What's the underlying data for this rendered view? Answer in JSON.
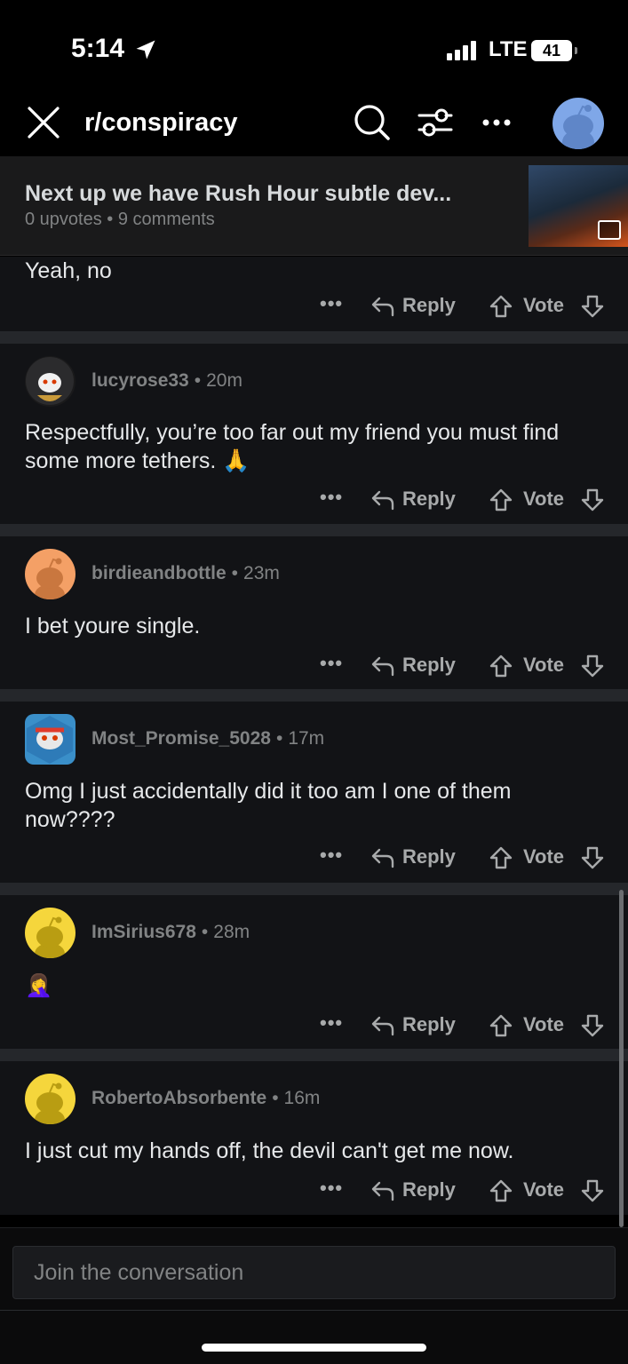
{
  "status_bar": {
    "time": "5:14",
    "network": "LTE",
    "battery": "41"
  },
  "header": {
    "subreddit": "r/conspiracy"
  },
  "post": {
    "title": "Next up we have Rush Hour  subtle dev...",
    "upvotes": "0 upvotes",
    "comments": "9 comments"
  },
  "actions": {
    "more": "•••",
    "reply": "Reply",
    "vote": "Vote"
  },
  "partial_comment": {
    "body": "Yeah, no"
  },
  "comments": [
    {
      "user": "lucyrose33",
      "ago": "20m",
      "body": "Respectfully, you’re too far out my friend you must find some more tethers. 🙏"
    },
    {
      "user": "birdieandbottle",
      "ago": "23m",
      "body": "I bet youre single."
    },
    {
      "user": "Most_Promise_5028",
      "ago": "17m",
      "body": "Omg I just accidentally did it too am I one of them now????"
    },
    {
      "user": "ImSirius678",
      "ago": "28m",
      "body": "🤦‍♀️"
    },
    {
      "user": "RobertoAbsorbente",
      "ago": "16m",
      "body": "I just cut my hands off, the devil can't get me now."
    }
  ],
  "composer": {
    "placeholder": "Join the conversation"
  },
  "colors": {
    "background": "#121316",
    "divider": "#25272b",
    "text": "#e6e8ea",
    "muted": "#818384"
  }
}
